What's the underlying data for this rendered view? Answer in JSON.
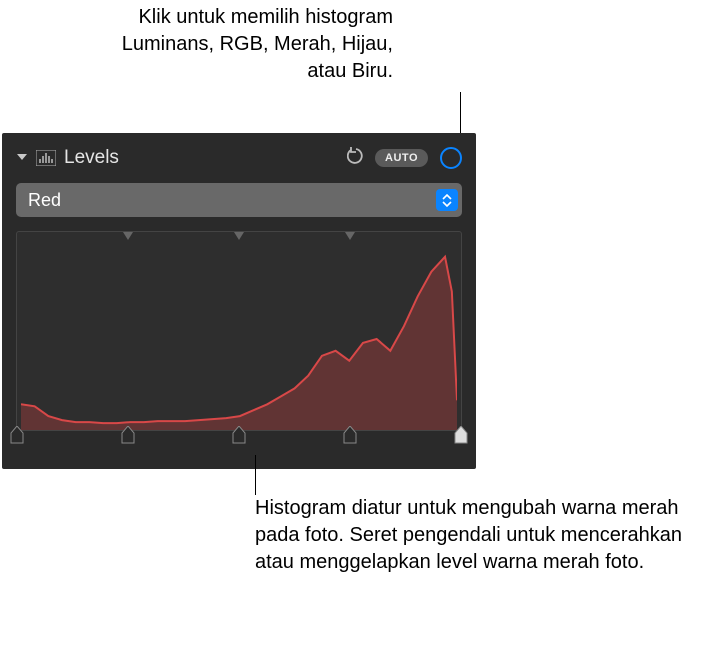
{
  "callouts": {
    "top": "Klik untuk memilih histogram Luminans, RGB, Merah, Hijau, atau Biru.",
    "bottom": "Histogram diatur untuk mengubah warna merah pada foto. Seret pengendali untuk mencerahkan atau menggelapkan level warna merah foto."
  },
  "panel": {
    "title": "Levels",
    "auto_label": "AUTO"
  },
  "dropdown": {
    "selected": "Red"
  },
  "colors": {
    "accent": "#0a84ff",
    "hist_stroke": "#d84848",
    "hist_fill": "rgba(160,60,60,0.45)"
  },
  "chart_data": {
    "type": "area",
    "title": "Red channel histogram",
    "xlabel": "",
    "ylabel": "",
    "xlim": [
      0,
      255
    ],
    "ylim": [
      0,
      190
    ],
    "x": [
      0,
      8,
      16,
      24,
      32,
      40,
      48,
      56,
      64,
      72,
      80,
      88,
      96,
      104,
      112,
      120,
      128,
      136,
      144,
      152,
      160,
      168,
      176,
      184,
      192,
      200,
      208,
      216,
      224,
      232,
      240,
      248,
      252,
      255
    ],
    "values": [
      26,
      24,
      14,
      10,
      8,
      8,
      7,
      7,
      8,
      8,
      9,
      9,
      9,
      10,
      11,
      12,
      14,
      20,
      26,
      34,
      42,
      55,
      75,
      80,
      70,
      88,
      92,
      80,
      105,
      135,
      160,
      175,
      140,
      30
    ]
  },
  "top_ticks": [
    25,
    50,
    75
  ],
  "bottom_handles": [
    0,
    25,
    50,
    75,
    100
  ]
}
